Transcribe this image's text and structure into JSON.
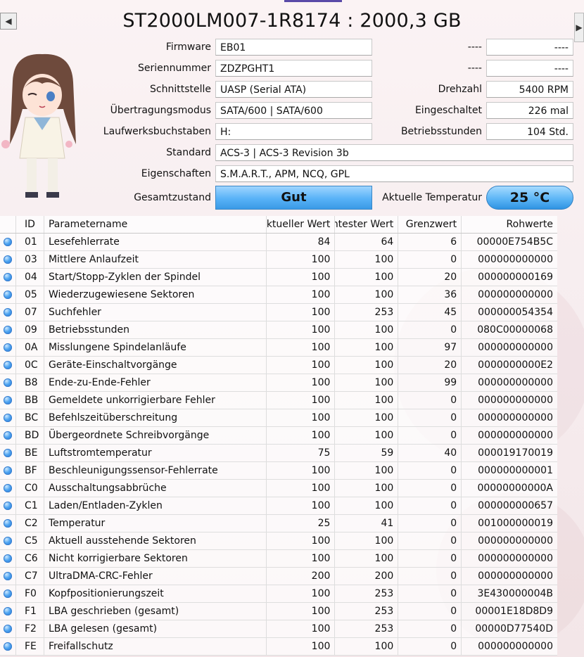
{
  "title": "ST2000LM007-1R8174 : 2000,3 GB",
  "info": {
    "firmware_label": "Firmware",
    "firmware": "EB01",
    "serial_label": "Seriennummer",
    "serial": "ZDZPGHT1",
    "interface_label": "Schnittstelle",
    "interface": "UASP (Serial ATA)",
    "transfer_label": "Übertragungsmodus",
    "transfer": "SATA/600 | SATA/600",
    "drive_letter_label": "Laufwerksbuchstaben",
    "drive_letter": "H:",
    "standard_label": "Standard",
    "standard": "ACS-3 | ACS-3 Revision 3b",
    "features_label": "Eigenschaften",
    "features": "S.M.A.R.T., APM, NCQ, GPL",
    "right_dash1_label": "----",
    "right_dash1": "----",
    "right_dash2_label": "----",
    "right_dash2": "----",
    "rpm_label": "Drehzahl",
    "rpm": "5400 RPM",
    "power_on_count_label": "Eingeschaltet",
    "power_on_count": "226 mal",
    "power_on_hours_label": "Betriebsstunden",
    "power_on_hours": "104 Std.",
    "health_label": "Gesamtzustand",
    "health": "Gut",
    "temp_label": "Aktuelle Temperatur",
    "temp": "25 °C"
  },
  "table": {
    "headers": [
      "ID",
      "Parametername",
      "Aktueller Wert",
      "Schlechtester Wert",
      "Grenzwert",
      "Rohwerte"
    ],
    "rows": [
      {
        "id": "01",
        "name": "Lesefehlerrate",
        "cur": "84",
        "worst": "64",
        "thr": "6",
        "raw": "00000E754B5C"
      },
      {
        "id": "03",
        "name": "Mittlere Anlaufzeit",
        "cur": "100",
        "worst": "100",
        "thr": "0",
        "raw": "000000000000"
      },
      {
        "id": "04",
        "name": "Start/Stopp-Zyklen der Spindel",
        "cur": "100",
        "worst": "100",
        "thr": "20",
        "raw": "000000000169"
      },
      {
        "id": "05",
        "name": "Wiederzugewiesene Sektoren",
        "cur": "100",
        "worst": "100",
        "thr": "36",
        "raw": "000000000000"
      },
      {
        "id": "07",
        "name": "Suchfehler",
        "cur": "100",
        "worst": "253",
        "thr": "45",
        "raw": "000000054354"
      },
      {
        "id": "09",
        "name": "Betriebsstunden",
        "cur": "100",
        "worst": "100",
        "thr": "0",
        "raw": "080C00000068"
      },
      {
        "id": "0A",
        "name": "Misslungene Spindelanläufe",
        "cur": "100",
        "worst": "100",
        "thr": "97",
        "raw": "000000000000"
      },
      {
        "id": "0C",
        "name": "Geräte-Einschaltvorgänge",
        "cur": "100",
        "worst": "100",
        "thr": "20",
        "raw": "0000000000E2"
      },
      {
        "id": "B8",
        "name": "Ende-zu-Ende-Fehler",
        "cur": "100",
        "worst": "100",
        "thr": "99",
        "raw": "000000000000"
      },
      {
        "id": "BB",
        "name": "Gemeldete unkorrigierbare Fehler",
        "cur": "100",
        "worst": "100",
        "thr": "0",
        "raw": "000000000000"
      },
      {
        "id": "BC",
        "name": "Befehlszeitüberschreitung",
        "cur": "100",
        "worst": "100",
        "thr": "0",
        "raw": "000000000000"
      },
      {
        "id": "BD",
        "name": "Übergeordnete Schreibvorgänge",
        "cur": "100",
        "worst": "100",
        "thr": "0",
        "raw": "000000000000"
      },
      {
        "id": "BE",
        "name": "Luftstromtemperatur",
        "cur": "75",
        "worst": "59",
        "thr": "40",
        "raw": "000019170019"
      },
      {
        "id": "BF",
        "name": "Beschleunigungssensor-Fehlerrate",
        "cur": "100",
        "worst": "100",
        "thr": "0",
        "raw": "000000000001"
      },
      {
        "id": "C0",
        "name": "Ausschaltungsabbrüche",
        "cur": "100",
        "worst": "100",
        "thr": "0",
        "raw": "00000000000A"
      },
      {
        "id": "C1",
        "name": "Laden/Entladen-Zyklen",
        "cur": "100",
        "worst": "100",
        "thr": "0",
        "raw": "000000000657"
      },
      {
        "id": "C2",
        "name": "Temperatur",
        "cur": "25",
        "worst": "41",
        "thr": "0",
        "raw": "001000000019"
      },
      {
        "id": "C5",
        "name": "Aktuell ausstehende Sektoren",
        "cur": "100",
        "worst": "100",
        "thr": "0",
        "raw": "000000000000"
      },
      {
        "id": "C6",
        "name": "Nicht korrigierbare Sektoren",
        "cur": "100",
        "worst": "100",
        "thr": "0",
        "raw": "000000000000"
      },
      {
        "id": "C7",
        "name": "UltraDMA-CRC-Fehler",
        "cur": "200",
        "worst": "200",
        "thr": "0",
        "raw": "000000000000"
      },
      {
        "id": "F0",
        "name": "Kopfpositionierungszeit",
        "cur": "100",
        "worst": "253",
        "thr": "0",
        "raw": "3E430000004B"
      },
      {
        "id": "F1",
        "name": "LBA geschrieben (gesamt)",
        "cur": "100",
        "worst": "253",
        "thr": "0",
        "raw": "00001E18D8D9"
      },
      {
        "id": "F2",
        "name": "LBA gelesen (gesamt)",
        "cur": "100",
        "worst": "253",
        "thr": "0",
        "raw": "00000D77540D"
      },
      {
        "id": "FE",
        "name": "Freifallschutz",
        "cur": "100",
        "worst": "100",
        "thr": "0",
        "raw": "000000000000"
      }
    ]
  },
  "colors": {
    "health_blue": "#58b2f7",
    "status_dot": "#4ea4f0"
  },
  "icons": {
    "prev": "triangle-left",
    "next": "triangle-right",
    "status": "blue-circle"
  }
}
